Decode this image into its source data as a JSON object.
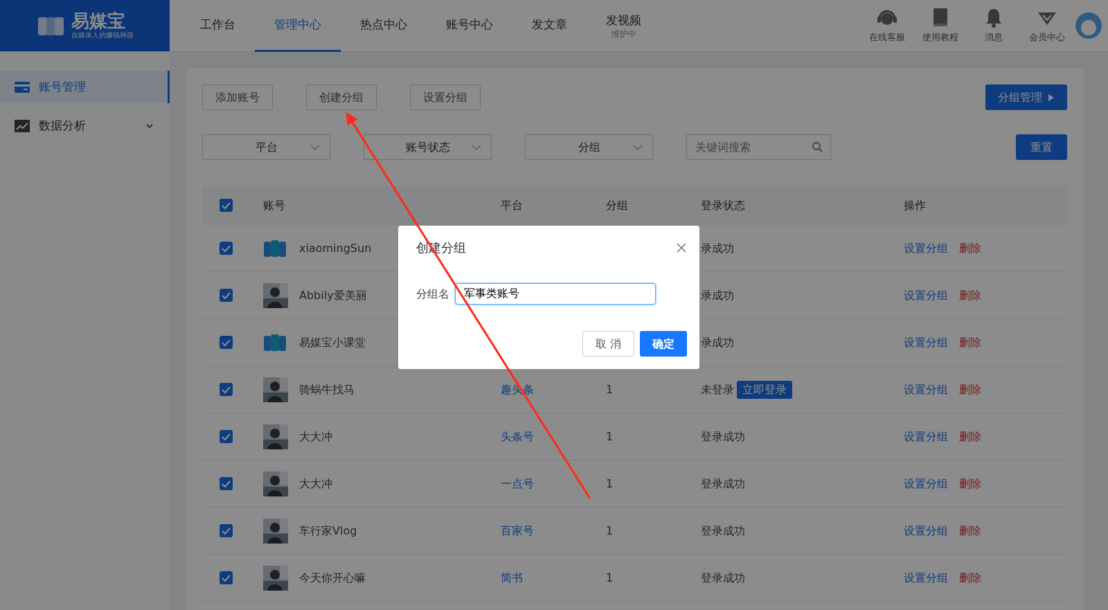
{
  "logo": {
    "name": "易媒宝",
    "slogan": "自媒体人的赚钱神器"
  },
  "nav": [
    {
      "label": "工作台",
      "selected": false
    },
    {
      "label": "管理中心",
      "selected": true
    },
    {
      "label": "热点中心",
      "selected": false
    },
    {
      "label": "账号中心",
      "selected": false
    },
    {
      "label": "发文章",
      "selected": false
    },
    {
      "label": "发视频",
      "selected": false,
      "note": "维护中"
    }
  ],
  "header_tools": [
    {
      "kind": "headset",
      "label": "在线客服"
    },
    {
      "kind": "book",
      "label": "使用教程"
    },
    {
      "kind": "bell",
      "label": "消息"
    },
    {
      "kind": "diamond",
      "label": "会员中心"
    }
  ],
  "sidebar": [
    {
      "kind": "card",
      "label": "账号管理",
      "selected": true
    },
    {
      "kind": "chart",
      "label": "数据分析",
      "selected": false,
      "has_submenu": true
    }
  ],
  "toolbar": {
    "buttons": [
      "添加账号",
      "创建分组",
      "设置分组"
    ],
    "manage_button": "分组管理"
  },
  "filters": {
    "selects": [
      "平台",
      "账号状态",
      "分组"
    ],
    "search": {
      "placeholder": "关键词搜索"
    },
    "reset": "重置"
  },
  "table": {
    "select_all": {
      "checked": true
    },
    "columns": [
      "账号",
      "平台",
      "分组",
      "登录状态",
      "操作"
    ],
    "rows": [
      {
        "checked": true,
        "avatar": {
          "kind": "logo"
        },
        "name": "xiaomingSun",
        "status": "录成功",
        "actions": [
          "设置分组",
          "删除"
        ]
      },
      {
        "checked": true,
        "avatar": {
          "kind": "picture"
        },
        "name": "Abbily爱美丽",
        "status": "录成功",
        "actions": [
          "设置分组",
          "删除"
        ]
      },
      {
        "checked": true,
        "avatar": {
          "kind": "logo"
        },
        "name": "易媒宝小课堂",
        "status": "录成功",
        "actions": [
          "设置分组",
          "删除"
        ]
      },
      {
        "checked": true,
        "avatar": {
          "kind": "picture"
        },
        "name": "骑蜗牛找马",
        "platform": "趣头条",
        "group": "1",
        "status": "未登录",
        "login_button": "立即登录",
        "actions": [
          "设置分组",
          "删除"
        ]
      },
      {
        "checked": true,
        "avatar": {
          "kind": "picture"
        },
        "name": "大大冲",
        "platform": "头条号",
        "group": "1",
        "status": "登录成功",
        "actions": [
          "设置分组",
          "删除"
        ]
      },
      {
        "checked": true,
        "avatar": {
          "kind": "picture"
        },
        "name": "大大冲",
        "platform": "一点号",
        "group": "1",
        "status": "登录成功",
        "actions": [
          "设置分组",
          "删除"
        ]
      },
      {
        "checked": true,
        "avatar": {
          "kind": "picture"
        },
        "name": "车行家Vlog",
        "platform": "百家号",
        "group": "1",
        "status": "登录成功",
        "actions": [
          "设置分组",
          "删除"
        ]
      },
      {
        "checked": true,
        "avatar": {
          "kind": "picture"
        },
        "name": "今天你开心嘛",
        "platform": "简书",
        "group": "1",
        "status": "登录成功",
        "actions": [
          "设置分组",
          "删除"
        ]
      }
    ]
  },
  "dialog": {
    "title": "创建分组",
    "field_label": "分组名",
    "value": "军事类账号",
    "cancel": "取 消",
    "confirm": "确定"
  }
}
